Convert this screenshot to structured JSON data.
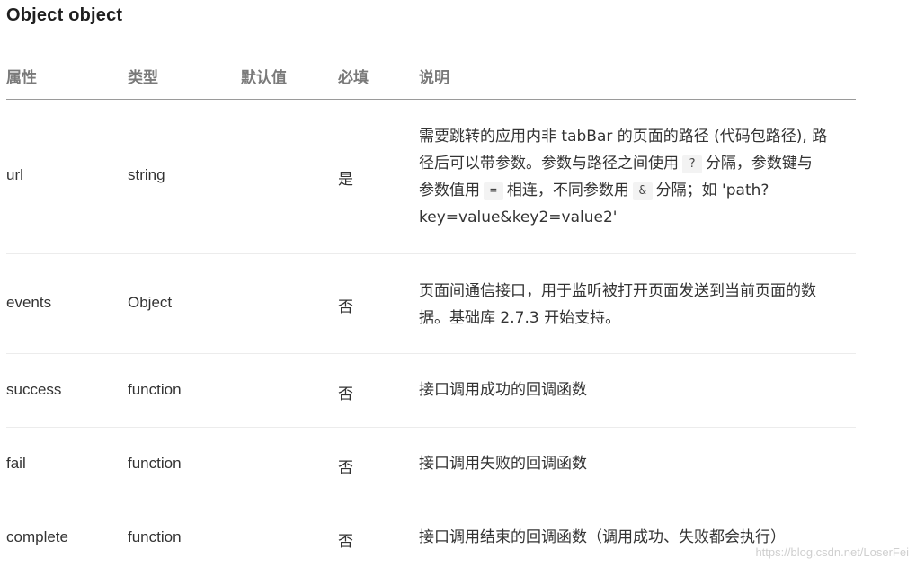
{
  "title": "Object object",
  "headers": {
    "attr": "属性",
    "type": "类型",
    "default": "默认值",
    "required": "必填",
    "desc": "说明"
  },
  "rows": [
    {
      "name": "url",
      "type": "string",
      "default": "",
      "required": "是",
      "desc": {
        "l1": "需要跳转的应用内非 tabBar 的页面的路径 (代码包路径), 路",
        "l2a": "径后可以带参数。参数与路径之间使用",
        "code1": "?",
        "l2b": "分隔，参数键与",
        "l3a": "参数值用",
        "code2": "=",
        "l3b": "相连，不同参数用",
        "code3": "&",
        "l3c": "分隔；如 'path?",
        "l4": "key=value&key2=value2'"
      }
    },
    {
      "name": "events",
      "type": "Object",
      "default": "",
      "required": "否",
      "desc": {
        "l1": "页面间通信接口，用于监听被打开页面发送到当前页面的数",
        "l2": "据。基础库 2.7.3 开始支持。"
      }
    },
    {
      "name": "success",
      "type": "function",
      "default": "",
      "required": "否",
      "desc": {
        "l1": "接口调用成功的回调函数"
      }
    },
    {
      "name": "fail",
      "type": "function",
      "default": "",
      "required": "否",
      "desc": {
        "l1": "接口调用失败的回调函数"
      }
    },
    {
      "name": "complete",
      "type": "function",
      "default": "",
      "required": "否",
      "desc": {
        "l1": "接口调用结束的回调函数（调用成功、失败都会执行）"
      }
    }
  ],
  "watermark": "https://blog.csdn.net/LoserFei"
}
